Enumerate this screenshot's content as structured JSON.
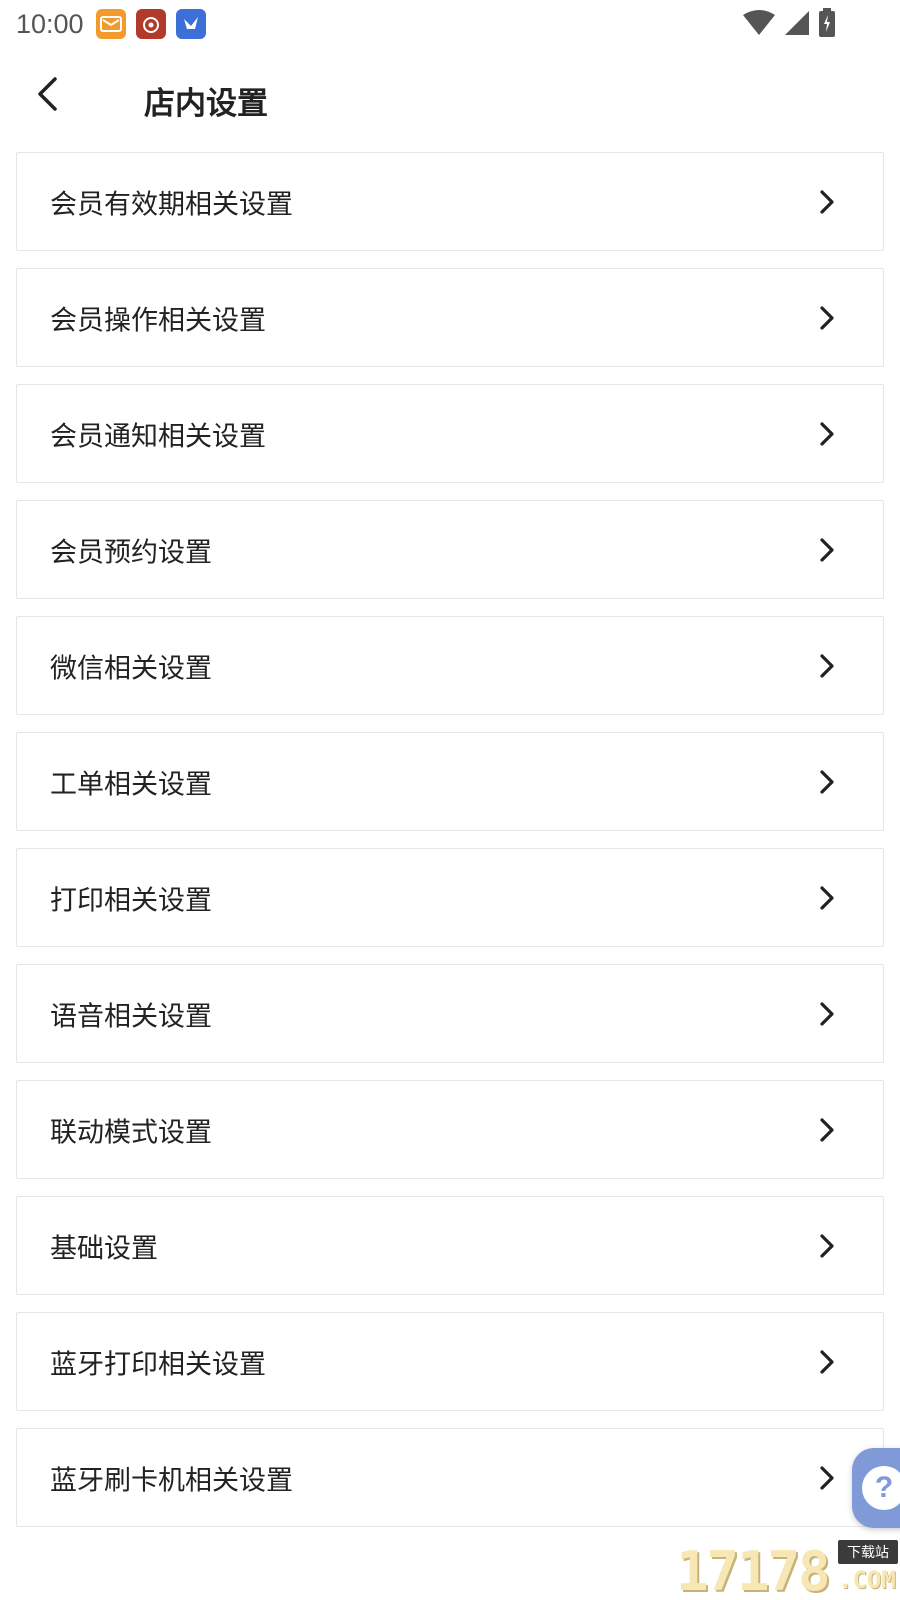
{
  "status_bar": {
    "time": "10:00",
    "notification_icons": [
      "mail-app-icon",
      "weibo-app-icon",
      "bird-app-icon"
    ],
    "system_icons": [
      "wifi-icon",
      "cell-signal-icon",
      "battery-icon"
    ]
  },
  "header": {
    "title": "店内设置",
    "back_icon": "chevron-left-icon"
  },
  "menu": {
    "items": [
      {
        "label": "会员有效期相关设置"
      },
      {
        "label": "会员操作相关设置"
      },
      {
        "label": "会员通知相关设置"
      },
      {
        "label": "会员预约设置"
      },
      {
        "label": "微信相关设置"
      },
      {
        "label": "工单相关设置"
      },
      {
        "label": "打印相关设置"
      },
      {
        "label": "语音相关设置"
      },
      {
        "label": "联动模式设置"
      },
      {
        "label": "基础设置"
      },
      {
        "label": "蓝牙打印相关设置"
      },
      {
        "label": "蓝牙刷卡机相关设置"
      }
    ],
    "chevron_icon": "chevron-right-icon"
  },
  "help_button": {
    "symbol": "?"
  },
  "watermark": {
    "number": "17178",
    "badge": "下载站",
    "sub": ".COM"
  },
  "colors": {
    "text_primary": "#222222",
    "border": "#e6e6e6",
    "help_accent": "#7f9ad6"
  }
}
